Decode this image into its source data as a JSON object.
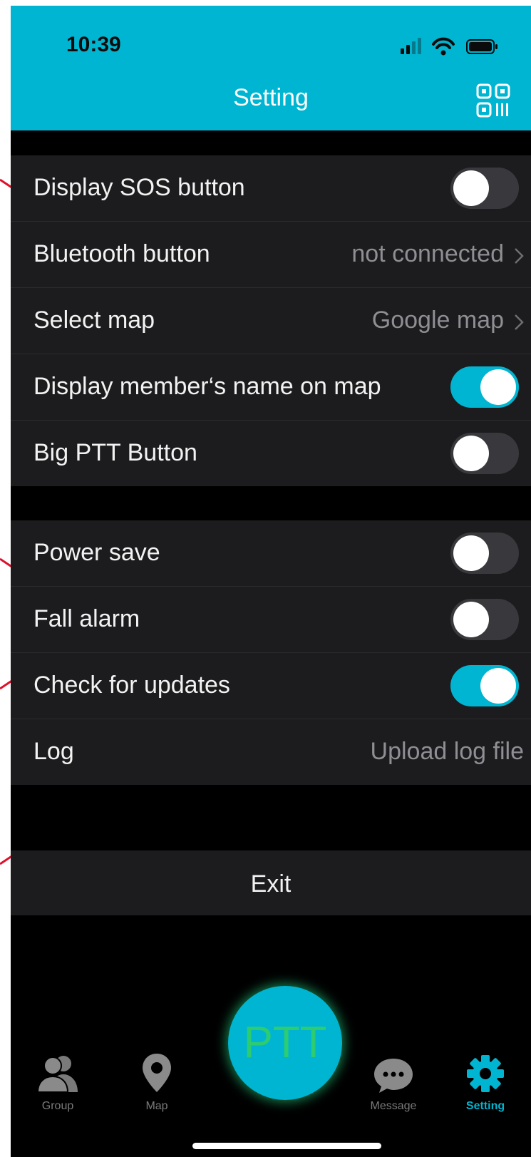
{
  "status_bar": {
    "time": "10:39"
  },
  "header": {
    "title": "Setting"
  },
  "section1": [
    {
      "label": "Display SOS button",
      "type": "toggle",
      "on": false
    },
    {
      "label": "Bluetooth button",
      "type": "link",
      "value": "not connected"
    },
    {
      "label": "Select map",
      "type": "link",
      "value": "Google map"
    },
    {
      "label": "Display member‘s name on map",
      "type": "toggle",
      "on": true
    },
    {
      "label": "Big PTT Button",
      "type": "toggle",
      "on": false
    }
  ],
  "section2": [
    {
      "label": "Power save",
      "type": "toggle",
      "on": false
    },
    {
      "label": "Fall alarm",
      "type": "toggle",
      "on": false
    },
    {
      "label": "Check for updates",
      "type": "toggle",
      "on": true
    },
    {
      "label": "Log",
      "type": "text",
      "value": "Upload log file"
    }
  ],
  "exit_label": "Exit",
  "ptt_label": "PTT",
  "tabs": [
    {
      "label": "Group",
      "icon": "group-icon",
      "active": false
    },
    {
      "label": "Map",
      "icon": "map-pin-icon",
      "active": false
    },
    {
      "label": "Message",
      "icon": "message-icon",
      "active": false
    },
    {
      "label": "Setting",
      "icon": "gear-icon",
      "active": true
    }
  ],
  "colors": {
    "accent": "#00b5d1",
    "background": "#000000",
    "cell": "#1c1c1e",
    "ptt_text": "#2ecc71"
  }
}
